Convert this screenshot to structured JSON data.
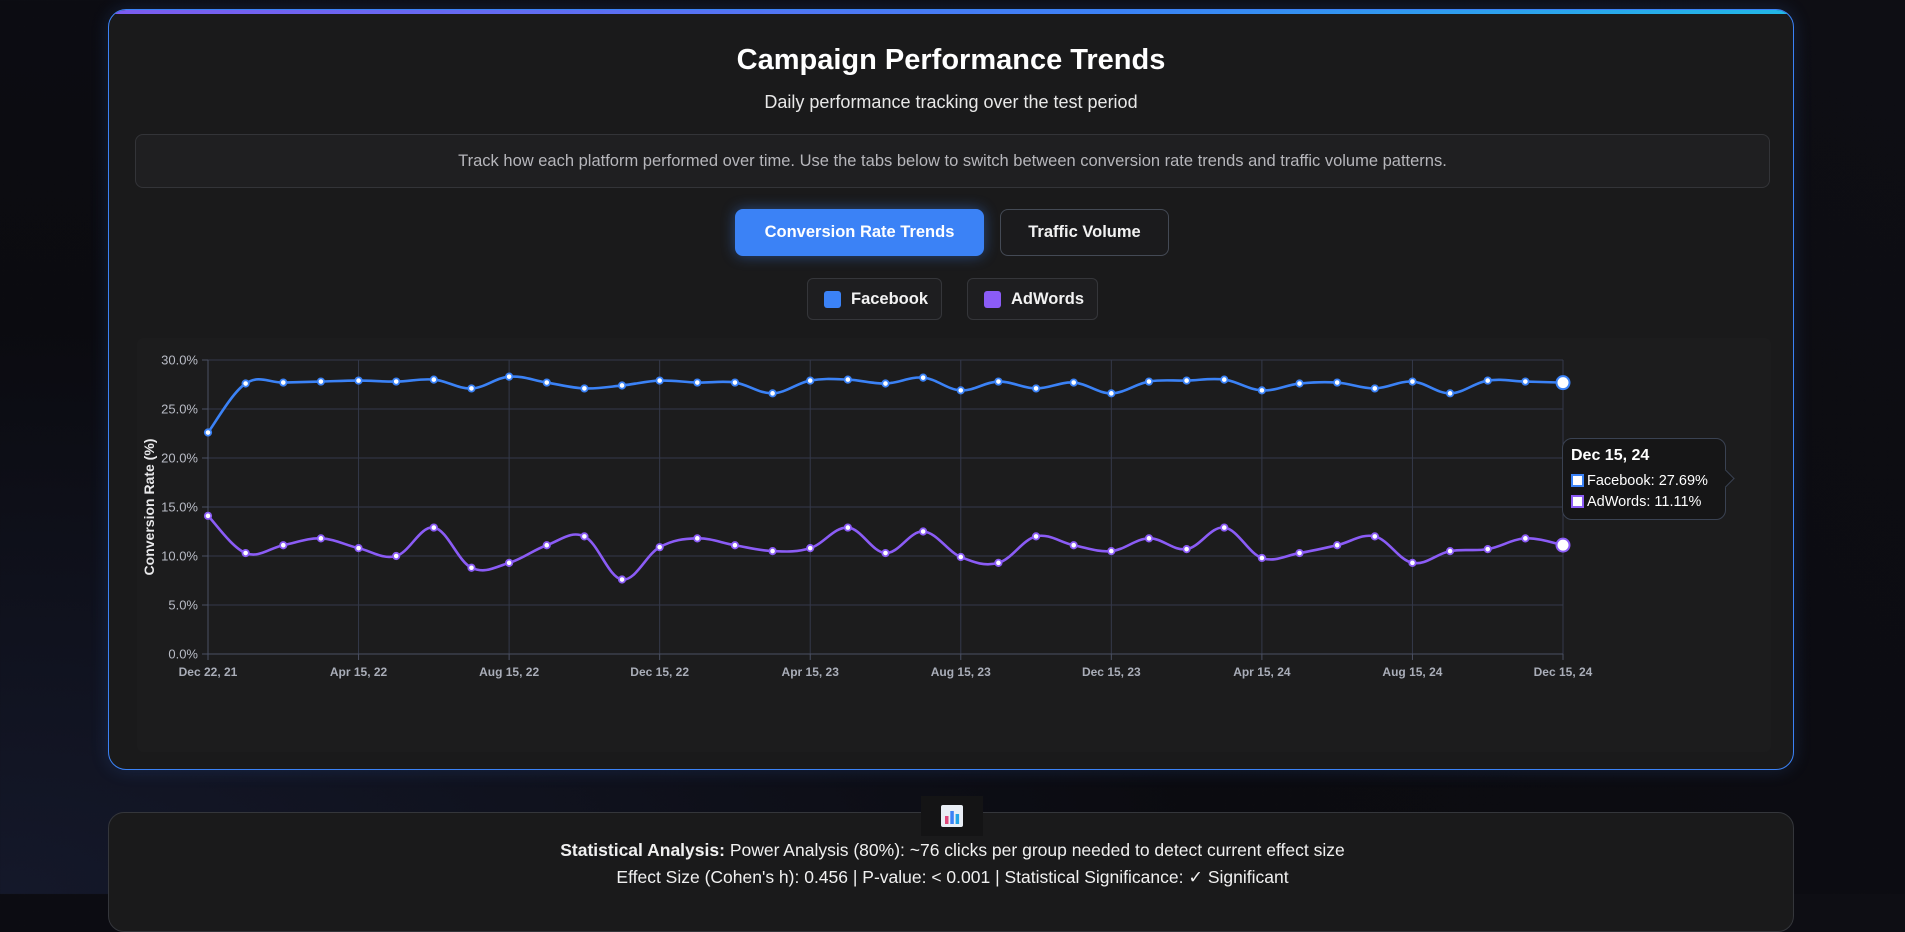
{
  "page": {
    "title": "Campaign Performance Trends",
    "subtitle": "Daily performance tracking over the test period",
    "info": "Track how each platform performed over time. Use the tabs below to switch between conversion rate trends and traffic volume patterns."
  },
  "tabs": [
    {
      "label": "Conversion Rate Trends",
      "active": true
    },
    {
      "label": "Traffic Volume",
      "active": false
    }
  ],
  "legend": [
    {
      "label": "Facebook",
      "color": "#3b82f6"
    },
    {
      "label": "AdWords",
      "color": "#8b5cf6"
    }
  ],
  "tooltip": {
    "date": "Dec 15, 24",
    "rows": [
      "Facebook: 27.69%",
      "AdWords: 11.11%"
    ]
  },
  "stats": {
    "icon": "bar-chart-icon",
    "label": "Statistical Analysis:",
    "line1": "Power Analysis (80%): ~76 clicks per group needed to detect current effect size",
    "line2": "Effect Size (Cohen's h): 0.456 | P-value: < 0.001 | Statistical Significance: ✓ Significant"
  },
  "chart_data": {
    "type": "line",
    "title": "",
    "xlabel": "",
    "ylabel": "Conversion Rate (%)",
    "ylim": [
      0,
      30
    ],
    "yticks": [
      "0.0%",
      "5.0%",
      "10.0%",
      "15.0%",
      "20.0%",
      "25.0%",
      "30.0%"
    ],
    "xticks": [
      "Dec 22, 21",
      "Apr 15, 22",
      "Aug 15, 22",
      "Dec 15, 22",
      "Apr 15, 23",
      "Aug 15, 23",
      "Dec 15, 23",
      "Apr 15, 24",
      "Aug 15, 24",
      "Dec 15, 24"
    ],
    "grid": true,
    "point_count": 37,
    "series": [
      {
        "name": "Facebook",
        "color": "#3b82f6",
        "values": [
          22.6,
          27.6,
          27.7,
          27.8,
          27.9,
          27.8,
          28.0,
          27.1,
          28.3,
          27.7,
          27.1,
          27.4,
          27.9,
          27.7,
          27.7,
          26.6,
          27.9,
          28.0,
          27.6,
          28.2,
          26.9,
          27.8,
          27.1,
          27.7,
          26.6,
          27.8,
          27.9,
          28.0,
          26.9,
          27.6,
          27.7,
          27.1,
          27.8,
          26.6,
          27.9,
          27.8,
          27.69
        ]
      },
      {
        "name": "AdWords",
        "color": "#8b5cf6",
        "values": [
          14.1,
          10.3,
          11.1,
          11.8,
          10.8,
          10.0,
          12.9,
          8.8,
          9.3,
          11.1,
          12.0,
          7.6,
          10.9,
          11.8,
          11.1,
          10.5,
          10.8,
          12.9,
          10.3,
          12.5,
          9.9,
          9.3,
          12.0,
          11.1,
          10.5,
          11.8,
          10.7,
          12.9,
          9.8,
          10.3,
          11.1,
          12.0,
          9.3,
          10.5,
          10.7,
          11.8,
          11.11
        ]
      }
    ]
  }
}
